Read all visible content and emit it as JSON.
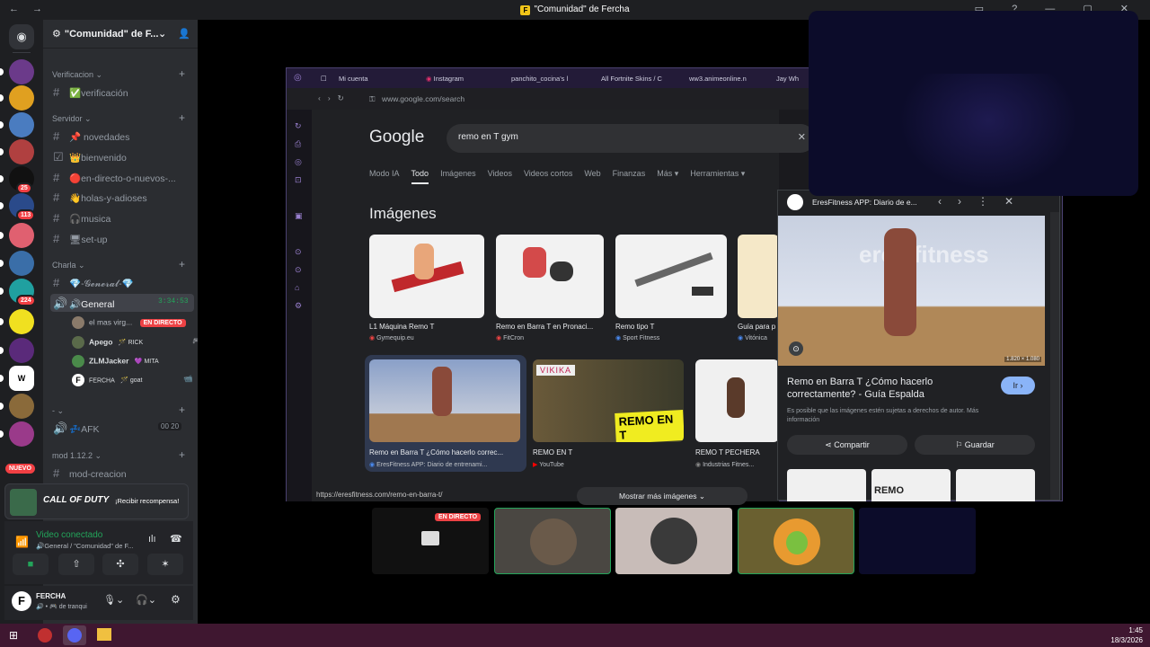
{
  "window": {
    "title": "\"Comunidad\" de Fercha",
    "nav": "← →"
  },
  "server": {
    "name": "\"Comunidad\" de F..."
  },
  "servers": [
    {
      "name": "gta",
      "color": "#6b3a8a"
    },
    {
      "name": "simpsons",
      "color": "#e0a020"
    },
    {
      "name": "character",
      "color": "#4a7cc0"
    },
    {
      "name": "anime",
      "color": "#b04040"
    },
    {
      "name": "s-logo",
      "color": "#111",
      "badge": "25"
    },
    {
      "name": "magia",
      "color": "#2a4a8a",
      "badge": "113"
    },
    {
      "name": "sunset",
      "color": "#e06070"
    },
    {
      "name": "shield",
      "color": "#3a6ea8"
    },
    {
      "name": "teal",
      "color": "#20a0a0",
      "badge": "224"
    },
    {
      "name": "f-logo",
      "color": "#f0e020"
    },
    {
      "name": "purple",
      "color": "#5a2a7a"
    },
    {
      "name": "wiki",
      "color": "#ffffff"
    },
    {
      "name": "brown",
      "color": "#8a6a3a"
    },
    {
      "name": "pink",
      "color": "#9a3a8a"
    }
  ],
  "categories": {
    "verificacion": "Verificacion",
    "servidor": "Servidor",
    "charla": "Charla",
    "dash": "-",
    "mod": "mod 1.12.2"
  },
  "channels": {
    "verificacion": "✅verificación",
    "novedades": "📌 novedades",
    "bienvenido": "👑bienvenido",
    "directo": "🔴en-directo-o-nuevos-...",
    "holas": "👋holas-y-adioses",
    "musica": "🎧musica",
    "setup": "🖥set-up",
    "general_text": "💎-𝓖𝓮𝓷𝓮𝓻𝓪𝓵-💎",
    "general_voice": "🔊General",
    "general_time": "3:34:53",
    "afk": "💤AFK",
    "afk_count": "00",
    "afk_limit": "20",
    "mod": "mod-creacion"
  },
  "voice_users": [
    {
      "name": "el mas virg...",
      "tag": "EN DIRECTO"
    },
    {
      "name": "Apego",
      "tag": "🪄 RICK"
    },
    {
      "name": "ZLMJacker",
      "tag": "💜 MITA"
    },
    {
      "name": "FERCHA",
      "tag": "🪄 goat"
    }
  ],
  "new_badge": "NUEVO",
  "promo": {
    "logo": "CALL OF DUTY",
    "cta": "¡Recibir recompensa!"
  },
  "voice_connection": {
    "status": "Video conectado",
    "channel": "🔊General / \"Comunidad\" de F..."
  },
  "user": {
    "name": "FERCHA",
    "status": "🔊 • 🎮 de tranqui"
  },
  "browser": {
    "tabs": [
      "Mi cuenta",
      "Instagram",
      "panchito_cocina's l",
      "All Fortnite Skins / C",
      "ww3.animeonline.n",
      "Jay Wh"
    ],
    "url": "www.google.com/search",
    "status_url": "https://eresfitness.com/remo-en-barra-t/"
  },
  "google": {
    "logo": "Google",
    "query": "remo en T gym",
    "tabs": [
      "Modo IA",
      "Todo",
      "Imágenes",
      "Videos",
      "Videos cortos",
      "Web",
      "Finanzas",
      "Más ▾",
      "Herramientas ▾"
    ],
    "heading": "Imágenes",
    "row1": [
      {
        "caption": "L1 Máquina Remo T",
        "source": "Gymequip.eu"
      },
      {
        "caption": "Remo en Barra T en Pronaci...",
        "source": "FitCron"
      },
      {
        "caption": "Remo tipo T",
        "source": "Sport Fitness"
      },
      {
        "caption": "Guía para p",
        "source": "Vitónica"
      }
    ],
    "row2": [
      {
        "caption": "Remo en Barra T ¿Cómo hacerlo correc...",
        "source": "EresFitness APP: Diario de entrenami..."
      },
      {
        "caption": "REMO EN T",
        "source": "YouTube",
        "overlay": "REMO EN T",
        "brand": "VIKIKA"
      },
      {
        "caption": "REMO T PECHERA",
        "source": "Industrias Fitnes..."
      }
    ],
    "more": "Mostrar más imágenes ⌄"
  },
  "panel": {
    "source": "EresFitness APP: Diario de e...",
    "title": "Remo en Barra T ¿Cómo hacerlo correctamente? - Guía Espalda",
    "go": "Ir ›",
    "note": "Es posible que las imágenes estén sujetas a derechos de autor. Más información",
    "share": "Compartir",
    "save": "Guardar",
    "dims": "1.820 × 1.080",
    "watermark": "eres fitness",
    "thumb_text": "REMO"
  },
  "tiles": {
    "live": "EN DIRECTO"
  },
  "taskbar": {
    "time": "1:45",
    "date": "18/3/2026"
  },
  "colors": {
    "accent": "#5865f2",
    "live": "#ed4245",
    "connected": "#23a55a"
  }
}
